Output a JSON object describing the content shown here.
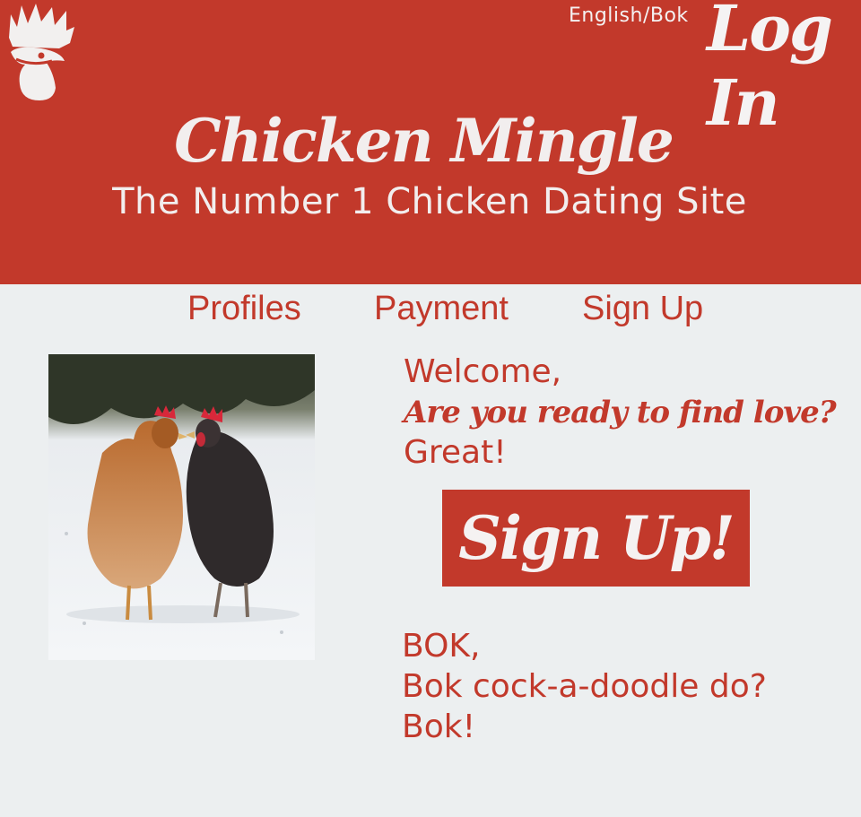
{
  "header": {
    "logo_icon": "rooster-head-icon",
    "language_toggle": "English/Bok",
    "login_label": "Log In",
    "title": "Chicken Mingle",
    "subtitle": "The Number 1 Chicken Dating Site"
  },
  "nav": {
    "items": [
      {
        "label": "Profiles"
      },
      {
        "label": "Payment"
      },
      {
        "label": "Sign Up"
      }
    ]
  },
  "main": {
    "photo_icon": "two-chickens-photo",
    "welcome": "Welcome,",
    "tagline": "Are you ready to find love?",
    "great": "Great!",
    "signup_button": "Sign Up!",
    "bok_lines": [
      "BOK,",
      "Bok cock-a-doodle do?",
      "Bok!"
    ]
  },
  "colors": {
    "brand_red": "#c2392b",
    "background": "#eceff0",
    "header_text": "#f2eeee"
  }
}
